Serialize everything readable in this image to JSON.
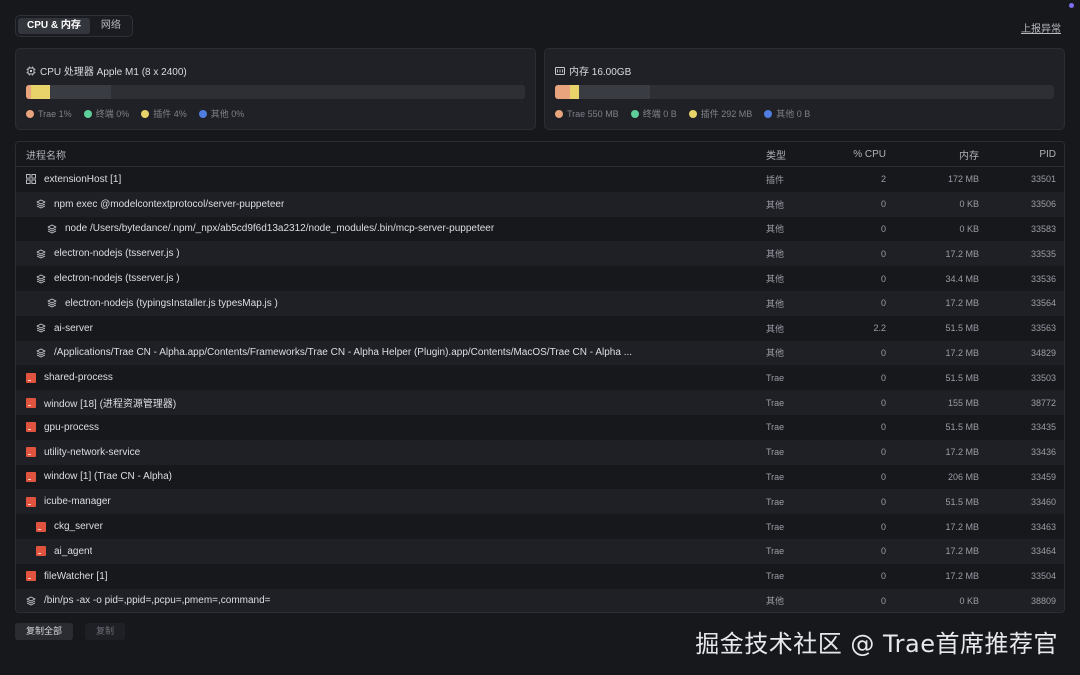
{
  "tabs": [
    {
      "label": "CPU & 内存",
      "active": true
    },
    {
      "label": "网络",
      "active": false
    }
  ],
  "report_link": "上报异常",
  "cpu_card": {
    "title": "CPU 处理器 Apple M1 (8 x 2400)",
    "icon": "cpu-icon",
    "segments": [
      {
        "name": "Trae",
        "percent": 1,
        "color": "#e8a47c"
      },
      {
        "name": "终端",
        "percent": 0,
        "color": "#5fcf9a"
      },
      {
        "name": "插件",
        "percent": 4,
        "color": "#e8d26a"
      },
      {
        "name": "其他",
        "percent": 0,
        "color": "#4f7de0"
      }
    ],
    "bar_track_fill_percent": 17,
    "legend": [
      {
        "label": "Trae",
        "value": "1%",
        "color": "#e8a47c"
      },
      {
        "label": "终端",
        "value": "0%",
        "color": "#5fcf9a"
      },
      {
        "label": "插件",
        "value": "4%",
        "color": "#e8d26a"
      },
      {
        "label": "其他",
        "value": "0%",
        "color": "#4f7de0"
      }
    ]
  },
  "mem_card": {
    "title": "内存 16.00GB",
    "icon": "memory-icon",
    "segments": [
      {
        "name": "Trae",
        "percent": 3.4,
        "color": "#e8a47c"
      },
      {
        "name": "终端",
        "percent": 0,
        "color": "#5fcf9a"
      },
      {
        "name": "插件",
        "percent": 1.8,
        "color": "#e8d26a"
      },
      {
        "name": "其他",
        "percent": 0,
        "color": "#4f7de0"
      }
    ],
    "bar_track_fill_percent": 19,
    "legend": [
      {
        "label": "Trae",
        "value": "550 MB",
        "color": "#e8a47c"
      },
      {
        "label": "终端",
        "value": "0 B",
        "color": "#5fcf9a"
      },
      {
        "label": "插件",
        "value": "292 MB",
        "color": "#e8d26a"
      },
      {
        "label": "其他",
        "value": "0 B",
        "color": "#4f7de0"
      }
    ]
  },
  "table": {
    "headers": {
      "name": "进程名称",
      "type": "类型",
      "cpu": "% CPU",
      "mem": "内存",
      "pid": "PID"
    },
    "rows": [
      {
        "name": "extensionHost [1]",
        "type": "插件",
        "cpu": "2",
        "mem": "172 MB",
        "pid": "33501",
        "depth": 0,
        "icon": "extension-icon"
      },
      {
        "name": "npm exec @modelcontextprotocol/server-puppeteer",
        "type": "其他",
        "cpu": "0",
        "mem": "0 KB",
        "pid": "33506",
        "depth": 1,
        "icon": "layers-icon"
      },
      {
        "name": "node /Users/bytedance/.npm/_npx/ab5cd9f6d13a2312/node_modules/.bin/mcp-server-puppeteer",
        "type": "其他",
        "cpu": "0",
        "mem": "0 KB",
        "pid": "33583",
        "depth": 2,
        "icon": "layers-icon"
      },
      {
        "name": "electron-nodejs (tsserver.js )",
        "type": "其他",
        "cpu": "0",
        "mem": "17.2 MB",
        "pid": "33535",
        "depth": 1,
        "icon": "layers-icon"
      },
      {
        "name": "electron-nodejs (tsserver.js )",
        "type": "其他",
        "cpu": "0",
        "mem": "34.4 MB",
        "pid": "33536",
        "depth": 1,
        "icon": "layers-icon"
      },
      {
        "name": "electron-nodejs (typingsInstaller.js typesMap.js )",
        "type": "其他",
        "cpu": "0",
        "mem": "17.2 MB",
        "pid": "33564",
        "depth": 2,
        "icon": "layers-icon"
      },
      {
        "name": "ai-server",
        "type": "其他",
        "cpu": "2.2",
        "mem": "51.5 MB",
        "pid": "33563",
        "depth": 1,
        "icon": "layers-icon"
      },
      {
        "name": "/Applications/Trae CN - Alpha.app/Contents/Frameworks/Trae CN - Alpha Helper (Plugin).app/Contents/MacOS/Trae CN - Alpha ...",
        "type": "其他",
        "cpu": "0",
        "mem": "17.2 MB",
        "pid": "34829",
        "depth": 1,
        "icon": "layers-icon"
      },
      {
        "name": "shared-process",
        "type": "Trae",
        "cpu": "0",
        "mem": "51.5 MB",
        "pid": "33503",
        "depth": 0,
        "icon": "trae-app-icon"
      },
      {
        "name": "window [18] (进程资源管理器)",
        "type": "Trae",
        "cpu": "0",
        "mem": "155 MB",
        "pid": "38772",
        "depth": 0,
        "icon": "trae-app-icon"
      },
      {
        "name": "gpu-process",
        "type": "Trae",
        "cpu": "0",
        "mem": "51.5 MB",
        "pid": "33435",
        "depth": 0,
        "icon": "trae-app-icon"
      },
      {
        "name": "utility-network-service",
        "type": "Trae",
        "cpu": "0",
        "mem": "17.2 MB",
        "pid": "33436",
        "depth": 0,
        "icon": "trae-app-icon"
      },
      {
        "name": "window [1] (Trae CN - Alpha)",
        "type": "Trae",
        "cpu": "0",
        "mem": "206 MB",
        "pid": "33459",
        "depth": 0,
        "icon": "trae-app-icon"
      },
      {
        "name": "icube-manager",
        "type": "Trae",
        "cpu": "0",
        "mem": "51.5 MB",
        "pid": "33460",
        "depth": 0,
        "icon": "trae-app-icon"
      },
      {
        "name": "ckg_server",
        "type": "Trae",
        "cpu": "0",
        "mem": "17.2 MB",
        "pid": "33463",
        "depth": 1,
        "icon": "trae-app-icon"
      },
      {
        "name": "ai_agent",
        "type": "Trae",
        "cpu": "0",
        "mem": "17.2 MB",
        "pid": "33464",
        "depth": 1,
        "icon": "trae-app-icon"
      },
      {
        "name": "fileWatcher [1]",
        "type": "Trae",
        "cpu": "0",
        "mem": "17.2 MB",
        "pid": "33504",
        "depth": 0,
        "icon": "trae-app-icon"
      },
      {
        "name": "/bin/ps -ax -o pid=,ppid=,pcpu=,pmem=,command=",
        "type": "其他",
        "cpu": "0",
        "mem": "0 KB",
        "pid": "38809",
        "depth": 0,
        "icon": "layers-icon"
      }
    ]
  },
  "buttons": {
    "copy_all": "复制全部",
    "copy": "复制"
  },
  "watermark": "掘金技术社区 @ Trae首席推荐官"
}
